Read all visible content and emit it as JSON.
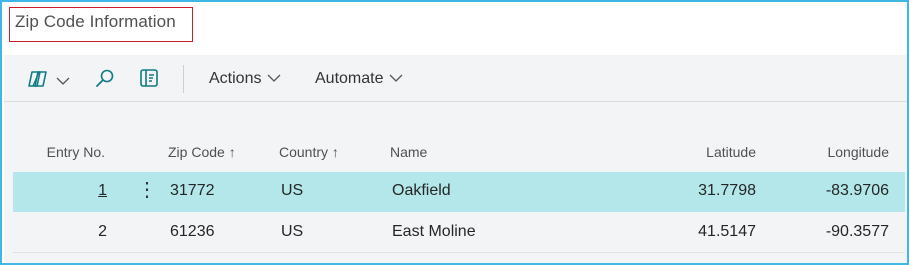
{
  "page": {
    "title": "Zip Code Information"
  },
  "toolbar": {
    "copilot_icon": "copilot-icon",
    "search_icon": "search-icon",
    "filter_pane_icon": "filter-pane-icon",
    "actions_label": "Actions",
    "automate_label": "Automate"
  },
  "table": {
    "headers": {
      "entry_no": "Entry No.",
      "zip_code": "Zip Code",
      "country": "Country",
      "name": "Name",
      "latitude": "Latitude",
      "longitude": "Longitude"
    },
    "sort_glyph": "↑",
    "rows": [
      {
        "entry_no": "1",
        "zip_code": "31772",
        "country": "US",
        "name": "Oakfield",
        "latitude": "31.7798",
        "longitude": "-83.9706",
        "selected": true
      },
      {
        "entry_no": "2",
        "zip_code": "61236",
        "country": "US",
        "name": "East Moline",
        "latitude": "41.5147",
        "longitude": "-90.3577",
        "selected": false
      }
    ],
    "row_menu_glyph": "⋮"
  },
  "colors": {
    "frame": "#3fb6e3",
    "title_outline": "#c8202a",
    "selected_row": "#b3e7ea",
    "accent": "#0f7b82"
  }
}
